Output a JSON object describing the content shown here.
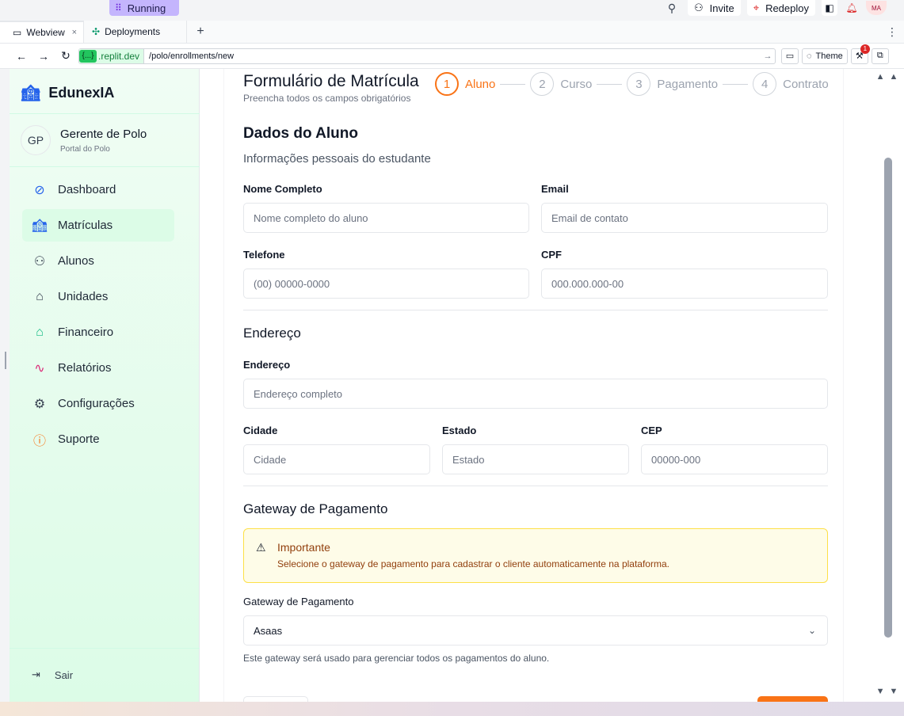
{
  "topbar": {
    "running": "Running",
    "invite": "Invite",
    "redeploy": "Redeploy",
    "avatar": "MA"
  },
  "tabs": [
    {
      "label": "Webview",
      "close": "×"
    },
    {
      "label": "Deployments"
    }
  ],
  "urlbar": {
    "host_chip": "{...}",
    "host": ".replit.dev",
    "path": "/polo/enrollments/new",
    "theme": "Theme",
    "notifications": "1"
  },
  "sidebar": {
    "brand": "EdunexIA",
    "user": {
      "initials": "GP",
      "name": "Gerente de Polo",
      "role": "Portal do Polo"
    },
    "items": [
      {
        "label": "Dashboard",
        "icon": "eye-off-icon",
        "color": "#2563eb"
      },
      {
        "label": "Matrículas",
        "icon": "school-icon",
        "color": "#2563eb"
      },
      {
        "label": "Alunos",
        "icon": "users-icon",
        "color": "#374151"
      },
      {
        "label": "Unidades",
        "icon": "store-icon",
        "color": "#374151"
      },
      {
        "label": "Financeiro",
        "icon": "bank-icon",
        "color": "#10b981"
      },
      {
        "label": "Relatórios",
        "icon": "chart-icon",
        "color": "#db2777"
      },
      {
        "label": "Configurações",
        "icon": "gear-icon",
        "color": "#374151"
      },
      {
        "label": "Suporte",
        "icon": "help-icon",
        "color": "#f97316"
      }
    ],
    "logout": "Sair"
  },
  "form": {
    "title": "Formulário de Matrícula",
    "subtitle": "Preencha todos os campos obrigatórios",
    "steps": [
      {
        "num": "1",
        "label": "Aluno"
      },
      {
        "num": "2",
        "label": "Curso"
      },
      {
        "num": "3",
        "label": "Pagamento"
      },
      {
        "num": "4",
        "label": "Contrato"
      }
    ],
    "student": {
      "title": "Dados do Aluno",
      "desc": "Informações pessoais do estudante",
      "name_label": "Nome Completo",
      "name_ph": "Nome completo do aluno",
      "email_label": "Email",
      "email_ph": "Email de contato",
      "phone_label": "Telefone",
      "phone_ph": "(00) 00000-0000",
      "cpf_label": "CPF",
      "cpf_ph": "000.000.000-00"
    },
    "address": {
      "title": "Endereço",
      "addr_label": "Endereço",
      "addr_ph": "Endereço completo",
      "city_label": "Cidade",
      "city_ph": "Cidade",
      "state_label": "Estado",
      "state_ph": "Estado",
      "cep_label": "CEP",
      "cep_ph": "00000-000"
    },
    "gateway": {
      "title": "Gateway de Pagamento",
      "alert_title": "Importante",
      "alert_msg": "Selecione o gateway de pagamento para cadastrar o cliente automaticamente na plataforma.",
      "select_label": "Gateway de Pagamento",
      "selected": "Asaas",
      "hint": "Este gateway será usado para gerenciar todos os pagamentos do aluno."
    }
  },
  "colors": {
    "accent": "#f97316",
    "sidebar_bg": "#dcfce7",
    "alert_bg": "#fefce8"
  }
}
